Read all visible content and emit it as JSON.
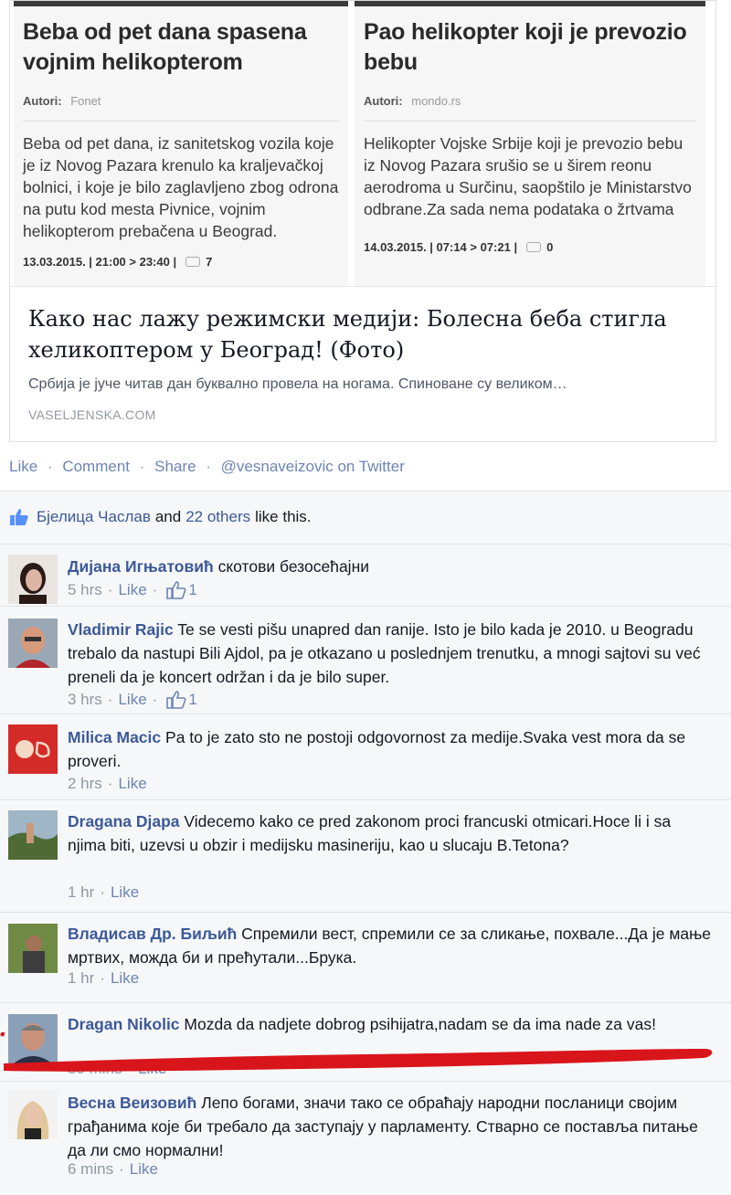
{
  "preview": {
    "left_article": {
      "title": "Beba od pet dana spasena vojnim helikopterom",
      "autori_label": "Autori:",
      "source": "Fonet",
      "body": "Beba od pet dana, iz sanitetskog vozila koje je iz Novog Pazara krenulo ka kraljevačkoj bolnici, i koje je bilo zaglavljeno zbog odrona na putu kod mesta Pivnice, vojnim helikopterom prebačena u Beograd.",
      "meta": "13.03.2015. | 21:00 > 23:40 |",
      "comments": "7"
    },
    "right_article": {
      "title": "Pao helikopter koji je prevozio bebu",
      "autori_label": "Autori:",
      "source": "mondo.rs",
      "body": "Helikopter Vojske Srbije koji je prevozio bebu iz Novog Pazara srušio se u širem reonu aerodroma u Surčinu, saopštilo je Ministarstvo odbrane.Za sada nema podataka o žrtvama",
      "meta": "14.03.2015. | 07:14 > 07:21 |",
      "comments": "0"
    },
    "title": "Како нас лажу режимски медији: Болесна беба стигла хеликоптером у Београд! (Фото)",
    "description": "Србија је јуче читав дан буквално провела на ногама. Спиноване су великом…",
    "domain": "VASELJENSKA.COM"
  },
  "actions": {
    "like": "Like",
    "comment": "Comment",
    "share": "Share",
    "twitter": "@vesnaveizovic on Twitter",
    "separator": "·"
  },
  "likes": {
    "first": "Бјелица Часлав",
    "and": "and",
    "others": "22 others",
    "suffix": "like this."
  },
  "comments": [
    {
      "author": "Дијана Игњатовић",
      "text": "скотови безосећајни",
      "time": "5 hrs",
      "like": "Like",
      "likes": "1"
    },
    {
      "author": "Vladimir Rajic",
      "text": "Te se vesti pišu unapred dan ranije. Isto je bilo kada je 2010. u Beogradu trebalo da nastupi Bili Ajdol, pa je otkazano u poslednjem trenutku, a mnogi sajtovi su već preneli da je koncert održan i da je bilo super.",
      "time": "3 hrs",
      "like": "Like",
      "likes": "1"
    },
    {
      "author": "Milica Macic",
      "text": "Pa to je zato sto ne postoji odgovornost za medije.Svaka vest mora da se proveri.",
      "time": "2 hrs",
      "like": "Like"
    },
    {
      "author": "Dragana Djapa",
      "text": "Videcemo kako ce pred zakonom proci francuski otmicari.Hoce li i sa njima biti, uzevsi u obzir i medijsku masineriju, kao u slucaju B.Tetona?",
      "time": "1 hr",
      "like": "Like"
    },
    {
      "author": "Владисав Др. Биљић",
      "text": "Спремили вест, спремили се за сликање, похвале...Да је мање мртвих, можда би и прећутали...Брука.",
      "time": "1 hr",
      "like": "Like"
    },
    {
      "author": "Dragan Nikolic",
      "text": "Mozda da nadjete dobrog psihijatra,nadam se da ima nade za vas!",
      "time": "50 mins",
      "like": "Like"
    },
    {
      "author": "Весна Веизовић",
      "text": "Лепо богами, значи тако се обраћају народни посланици својим грађанима које би требало да заступају у парламенту. Стварно се поставља питање да ли смо нормални!",
      "time": "6 mins",
      "like": "Like"
    }
  ],
  "colors": {
    "link": "#3b5998",
    "muted_link": "#6d84b4",
    "muted": "#9197a3",
    "annotation_red": "#d8151b"
  }
}
